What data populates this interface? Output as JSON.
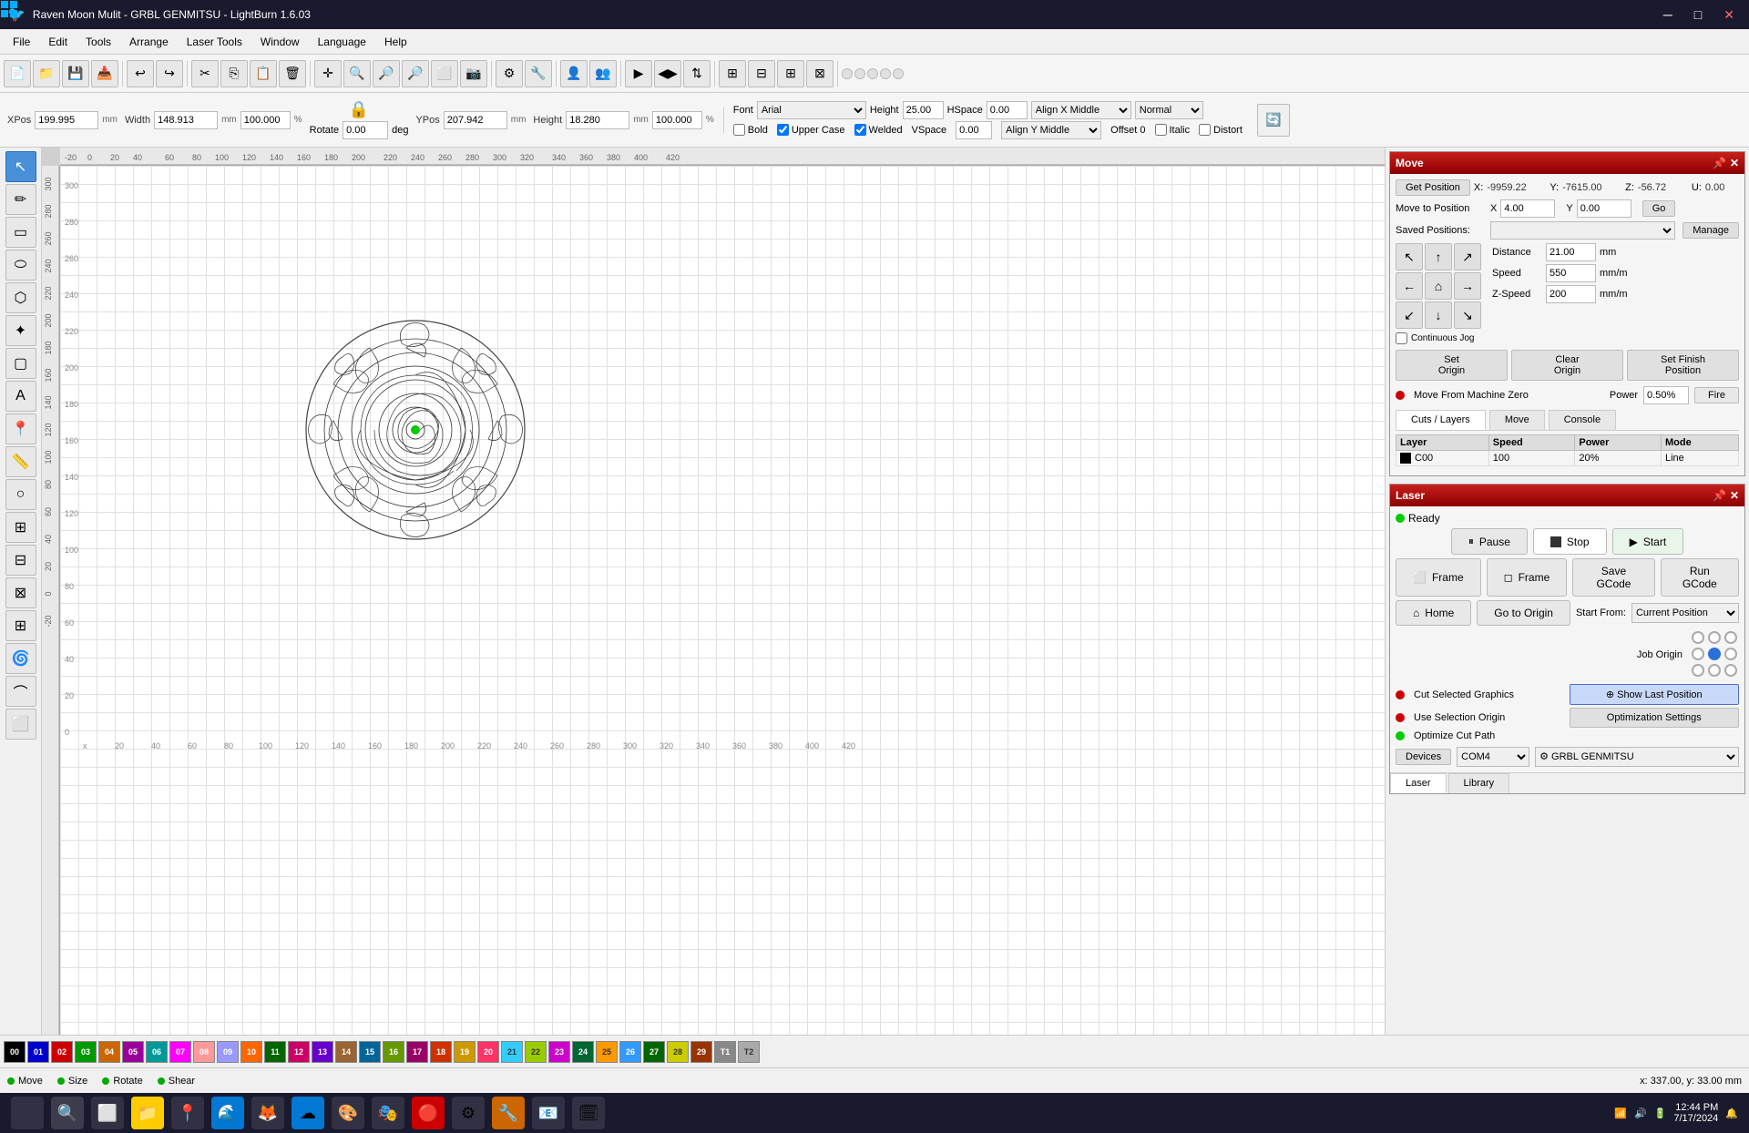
{
  "titlebar": {
    "title": "Raven Moon Mulit - GRBL GENMITSU - LightBurn 1.6.03",
    "minimize": "─",
    "maximize": "□",
    "close": "✕"
  },
  "menubar": {
    "items": [
      "File",
      "Edit",
      "Tools",
      "Arrange",
      "Laser Tools",
      "Window",
      "Language",
      "Help"
    ]
  },
  "propbar": {
    "xpos_label": "XPos",
    "xpos_value": "199.995",
    "ypos_label": "YPos",
    "ypos_value": "207.942",
    "unit": "mm",
    "width_label": "Width",
    "width_value": "148.913",
    "height_label": "Height",
    "height_value": "18.280",
    "pct1": "100.000",
    "pct2": "100.000",
    "rotate_label": "Rotate",
    "rotate_value": "0.00",
    "font_label": "Font",
    "font_value": "Arial",
    "height2_label": "Height",
    "height2_value": "25.00",
    "hspace_label": "HSpace",
    "hspace_value": "0.00",
    "vspace_label": "VSpace",
    "vspace_value": "0.00",
    "align_x": "Align X Middle",
    "align_y": "Align Y Middle",
    "normal": "Normal",
    "offset": "Offset 0",
    "bold": "Bold",
    "upper_case": "Upper Case",
    "welded": "Welded",
    "italic": "Italic",
    "distort": "Distort"
  },
  "move_panel": {
    "title": "Move",
    "get_position": "Get Position",
    "x_label": "X:",
    "x_value": "-9959.22",
    "y_label": "Y:",
    "y_value": "-7615.00",
    "z_label": "Z:",
    "z_value": "-56.72",
    "u_label": "U:",
    "u_value": "0.00",
    "move_to_position": "Move to Position",
    "x_move": "4.00",
    "y_move": "0.00",
    "go": "Go",
    "saved_positions": "Saved Positions:",
    "manage": "Manage",
    "continuous_jog": "Continuous Jog",
    "distance_label": "Distance",
    "distance_value": "21.00",
    "dist_unit": "mm",
    "speed_label": "Speed",
    "speed_value": "550",
    "speed_unit": "mm/m",
    "zspeed_label": "Z-Speed",
    "zspeed_value": "200",
    "zspeed_unit": "mm/m",
    "set_origin": "Set\nOrigin",
    "clear_origin": "Clear\nOrigin",
    "set_finish": "Set Finish\nPosition",
    "move_from_zero": "Move From Machine Zero",
    "power_label": "Power",
    "power_value": "0.50%",
    "fire": "Fire"
  },
  "cuts_layers": {
    "tab_label": "Cuts / Layers",
    "move_tab": "Move",
    "console_tab": "Console"
  },
  "laser_panel": {
    "title": "Laser",
    "ready": "Ready",
    "pause": "Pause",
    "stop": "Stop",
    "start": "Start",
    "frame1": "Frame",
    "frame2": "Frame",
    "save_gcode": "Save GCode",
    "run_gcode": "Run GCode",
    "home": "Home",
    "go_to_origin": "Go to Origin",
    "start_from_label": "Start From:",
    "start_from_value": "Current Position",
    "job_origin": "Job Origin",
    "cut_selected": "Cut Selected Graphics",
    "use_selection": "Use Selection Origin",
    "show_last_pos": "⊕ Show Last Position",
    "optimize_cut": "Optimize Cut Path",
    "optimization_settings": "Optimization Settings",
    "devices": "Devices",
    "com": "COM4",
    "machine": "⚙ GRBL GENMITSU"
  },
  "colorbar": {
    "swatches": [
      {
        "label": "00",
        "color": "#000000"
      },
      {
        "label": "01",
        "color": "#0000ff"
      },
      {
        "label": "02",
        "color": "#ff0000"
      },
      {
        "label": "03",
        "color": "#00aa00"
      },
      {
        "label": "04",
        "color": "#cc6600"
      },
      {
        "label": "05",
        "color": "#aa00aa"
      },
      {
        "label": "06",
        "color": "#00aaaa"
      },
      {
        "label": "07",
        "color": "#ff00ff"
      },
      {
        "label": "08",
        "color": "#ffaaaa"
      },
      {
        "label": "09",
        "color": "#aaaaff"
      },
      {
        "label": "10",
        "color": "#ff6600"
      },
      {
        "label": "11",
        "color": "#009900"
      },
      {
        "label": "12",
        "color": "#cc0066"
      },
      {
        "label": "13",
        "color": "#6600cc"
      },
      {
        "label": "14",
        "color": "#996633"
      },
      {
        "label": "15",
        "color": "#006699"
      },
      {
        "label": "16",
        "color": "#669900"
      },
      {
        "label": "17",
        "color": "#990066"
      },
      {
        "label": "18",
        "color": "#cc3300"
      },
      {
        "label": "19",
        "color": "#cc9900"
      },
      {
        "label": "20",
        "color": "#ff3366"
      },
      {
        "label": "21",
        "color": "#33ccff"
      },
      {
        "label": "22",
        "color": "#99cc00"
      },
      {
        "label": "23",
        "color": "#cc00cc"
      },
      {
        "label": "24",
        "color": "#006633"
      },
      {
        "label": "25",
        "color": "#ff9900"
      },
      {
        "label": "26",
        "color": "#3399ff"
      },
      {
        "label": "27",
        "color": "#006600"
      },
      {
        "label": "28",
        "color": "#cccc00"
      },
      {
        "label": "29",
        "color": "#993300"
      },
      {
        "label": "T1",
        "color": "#888888"
      },
      {
        "label": "T2",
        "color": "#aaaaaa"
      }
    ]
  },
  "statusbar": {
    "move": "Move",
    "size": "Size",
    "rotate": "Rotate",
    "shear": "Shear",
    "coords": "x: 337.00, y: 33.00 mm"
  },
  "taskbar": {
    "time": "12:44 PM",
    "date": "7/17/2024"
  }
}
